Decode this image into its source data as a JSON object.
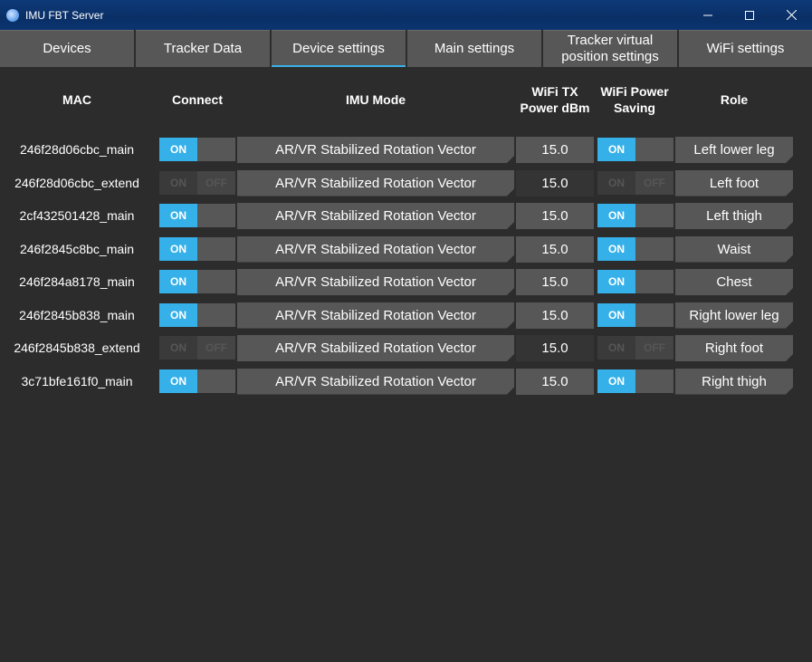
{
  "window": {
    "title": "IMU FBT Server",
    "controls": {
      "minimize": "—",
      "maximize": "☐",
      "close": "✕"
    }
  },
  "tabs": [
    {
      "label": "Devices",
      "active": false
    },
    {
      "label": "Tracker Data",
      "active": false
    },
    {
      "label": "Device settings",
      "active": true
    },
    {
      "label": "Main settings",
      "active": false
    },
    {
      "label": "Tracker virtual position settings",
      "active": false
    },
    {
      "label": "WiFi settings",
      "active": false
    }
  ],
  "columns": {
    "mac": "MAC",
    "connect": "Connect",
    "imu_mode": "IMU Mode",
    "tx_power": "WiFi TX Power dBm",
    "power_saving": "WiFi Power Saving",
    "role": "Role"
  },
  "switch_labels": {
    "on": "ON",
    "off": "OFF"
  },
  "colors": {
    "accent": "#36b0e8",
    "button": "#575757",
    "background": "#2c2c2c",
    "titlebar": "#0b3470"
  },
  "rows": [
    {
      "mac": "246f28d06cbc_main",
      "connect": true,
      "imu_mode": "AR/VR Stabilized Rotation Vector",
      "tx_power": "15.0",
      "power_saving": true,
      "role": "Left lower leg"
    },
    {
      "mac": "246f28d06cbc_extend",
      "connect": false,
      "imu_mode": "AR/VR Stabilized Rotation Vector",
      "tx_power": "15.0",
      "power_saving": false,
      "role": "Left foot"
    },
    {
      "mac": "2cf432501428_main",
      "connect": true,
      "imu_mode": "AR/VR Stabilized Rotation Vector",
      "tx_power": "15.0",
      "power_saving": true,
      "role": "Left thigh"
    },
    {
      "mac": "246f2845c8bc_main",
      "connect": true,
      "imu_mode": "AR/VR Stabilized Rotation Vector",
      "tx_power": "15.0",
      "power_saving": true,
      "role": "Waist"
    },
    {
      "mac": "246f284a8178_main",
      "connect": true,
      "imu_mode": "AR/VR Stabilized Rotation Vector",
      "tx_power": "15.0",
      "power_saving": true,
      "role": "Chest"
    },
    {
      "mac": "246f2845b838_main",
      "connect": true,
      "imu_mode": "AR/VR Stabilized Rotation Vector",
      "tx_power": "15.0",
      "power_saving": true,
      "role": "Right lower leg"
    },
    {
      "mac": "246f2845b838_extend",
      "connect": false,
      "imu_mode": "AR/VR Stabilized Rotation Vector",
      "tx_power": "15.0",
      "power_saving": false,
      "role": "Right foot"
    },
    {
      "mac": "3c71bfe161f0_main",
      "connect": true,
      "imu_mode": "AR/VR Stabilized Rotation Vector",
      "tx_power": "15.0",
      "power_saving": true,
      "role": "Right thigh"
    }
  ]
}
